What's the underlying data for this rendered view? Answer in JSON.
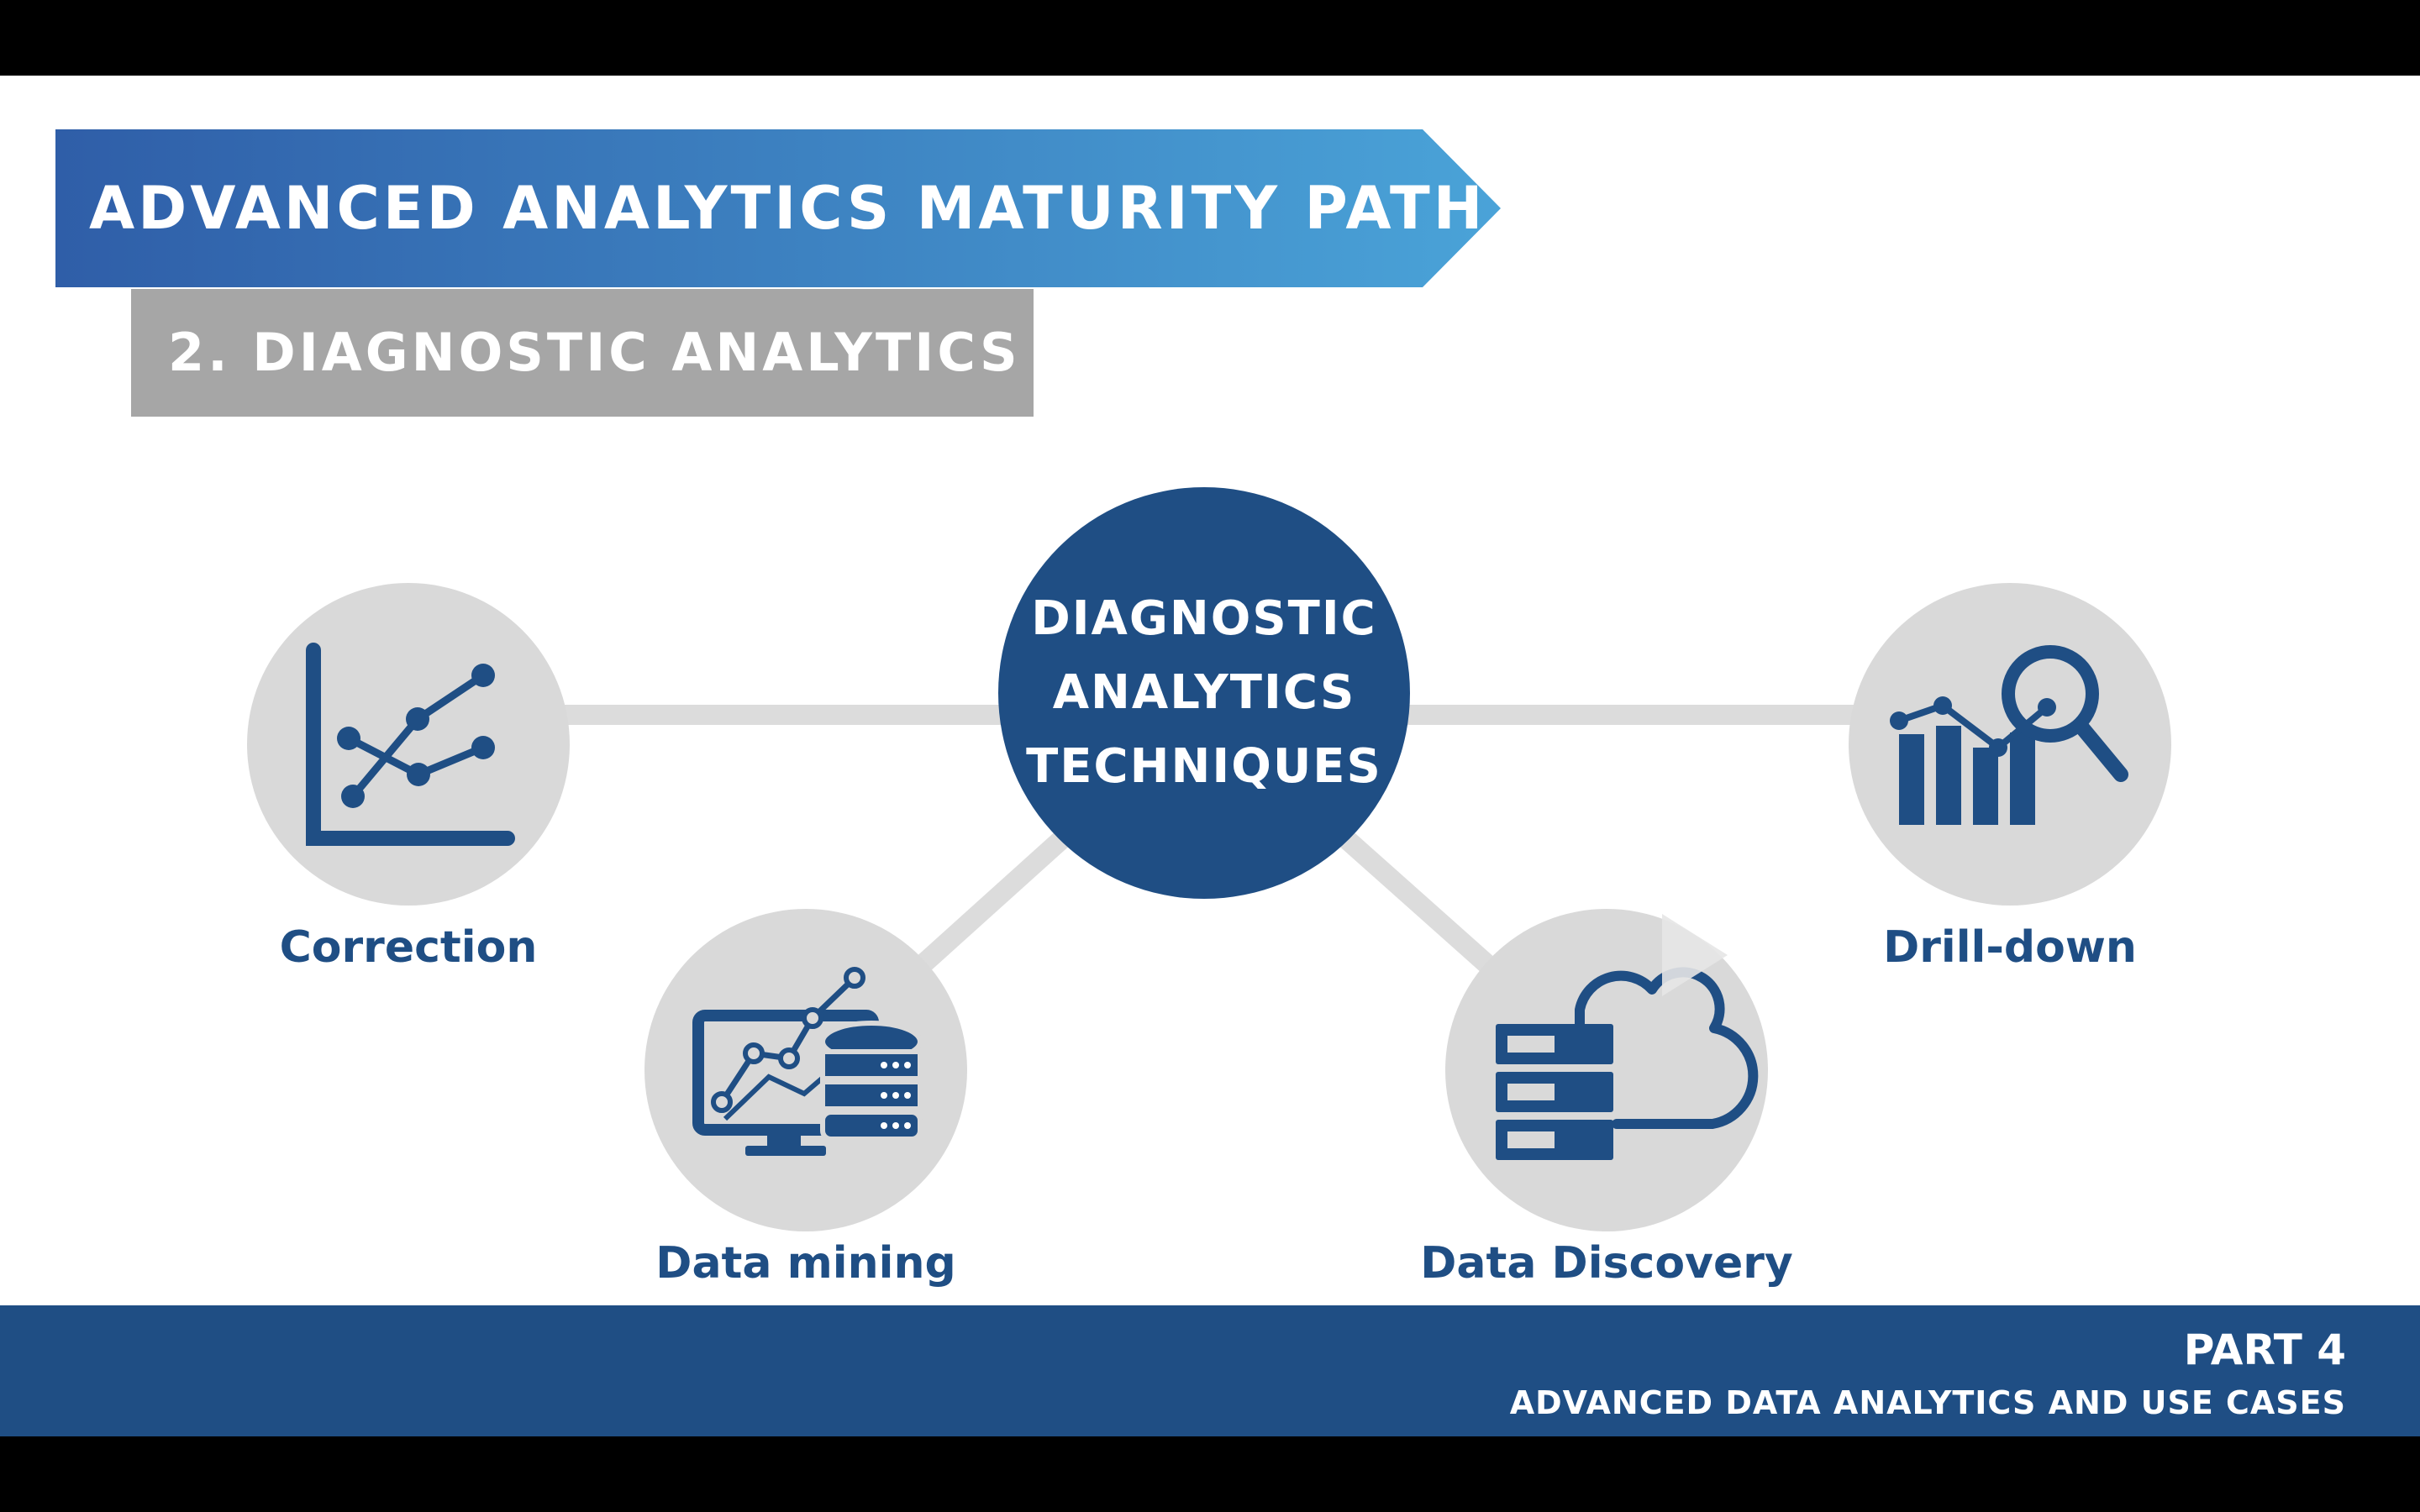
{
  "slide": {
    "title": "ADVANCED ANALYTICS MATURITY PATH",
    "subtitle": "2. DIAGNOSTIC ANALYTICS"
  },
  "center": {
    "lines": [
      "DIAGNOSTIC",
      "ANALYTICS",
      "TECHNIQUES"
    ]
  },
  "nodes": [
    {
      "label": "Correction",
      "icon": "line-chart-icon"
    },
    {
      "label": "Data mining",
      "icon": "data-mining-icon"
    },
    {
      "label": "Data Discovery",
      "icon": "server-cloud-icon"
    },
    {
      "label": "Drill-down",
      "icon": "magnifier-bar-chart-icon"
    }
  ],
  "footer": {
    "part": "PART 4",
    "subtitle": "ADVANCED DATA ANALYTICS AND USE CASES"
  },
  "colors": {
    "navy": "#1f4e84",
    "banner_start": "#2f5ea8",
    "banner_end": "#4aa3d8",
    "gray_box": "#a6a6a6",
    "circle_gray": "#d9d9d9",
    "connector": "#dcdcdc"
  }
}
